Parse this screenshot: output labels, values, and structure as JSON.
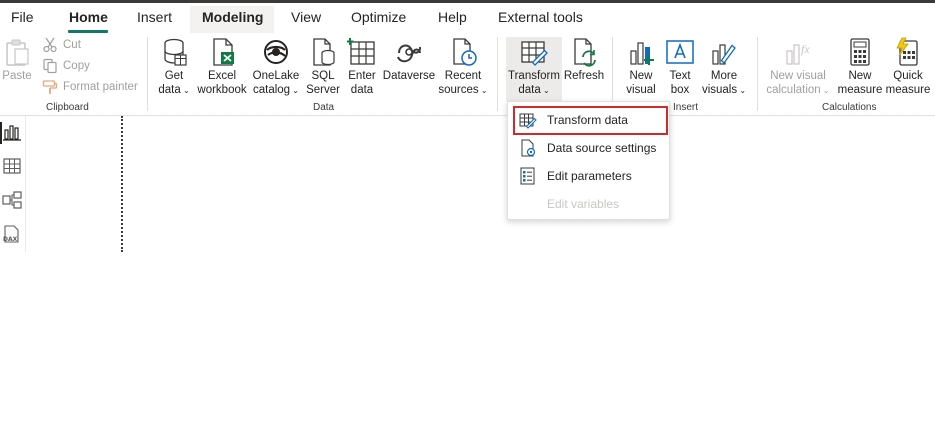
{
  "tabs": [
    {
      "label": "File"
    },
    {
      "label": "Home"
    },
    {
      "label": "Insert"
    },
    {
      "label": "Modeling"
    },
    {
      "label": "View"
    },
    {
      "label": "Optimize"
    },
    {
      "label": "Help"
    },
    {
      "label": "External tools"
    }
  ],
  "clipboard": {
    "paste": "Paste",
    "cut": "Cut",
    "copy": "Copy",
    "format_painter": "Format painter",
    "group_label": "Clipboard"
  },
  "data_group": {
    "get_data": [
      "Get",
      "data"
    ],
    "excel": [
      "Excel",
      "workbook"
    ],
    "onelake": [
      "OneLake",
      "catalog"
    ],
    "sql": [
      "SQL",
      "Server"
    ],
    "enter": [
      "Enter",
      "data"
    ],
    "dataverse": "Dataverse",
    "recent": [
      "Recent",
      "sources"
    ],
    "group_label": "Data"
  },
  "queries": {
    "transform": [
      "Transform",
      "data"
    ],
    "refresh": "Refresh"
  },
  "insert_group": {
    "new_visual": [
      "New",
      "visual"
    ],
    "text_box": [
      "Text",
      "box"
    ],
    "more_visuals": [
      "More",
      "visuals"
    ],
    "group_label": "Insert"
  },
  "calculations": {
    "new_visual_calc": [
      "New visual",
      "calculation"
    ],
    "new_measure": [
      "New",
      "measure"
    ],
    "quick_measure": [
      "Quick",
      "measure"
    ],
    "group_label": "Calculations"
  },
  "dropdown": {
    "items": [
      {
        "label": "Transform data"
      },
      {
        "label": "Data source settings"
      },
      {
        "label": "Edit parameters"
      },
      {
        "label": "Edit variables"
      }
    ]
  },
  "colors": {
    "accent": "#117865",
    "highlight": "#d12a2a",
    "excel_green": "#107c41",
    "power_yellow": "#f2c811"
  }
}
